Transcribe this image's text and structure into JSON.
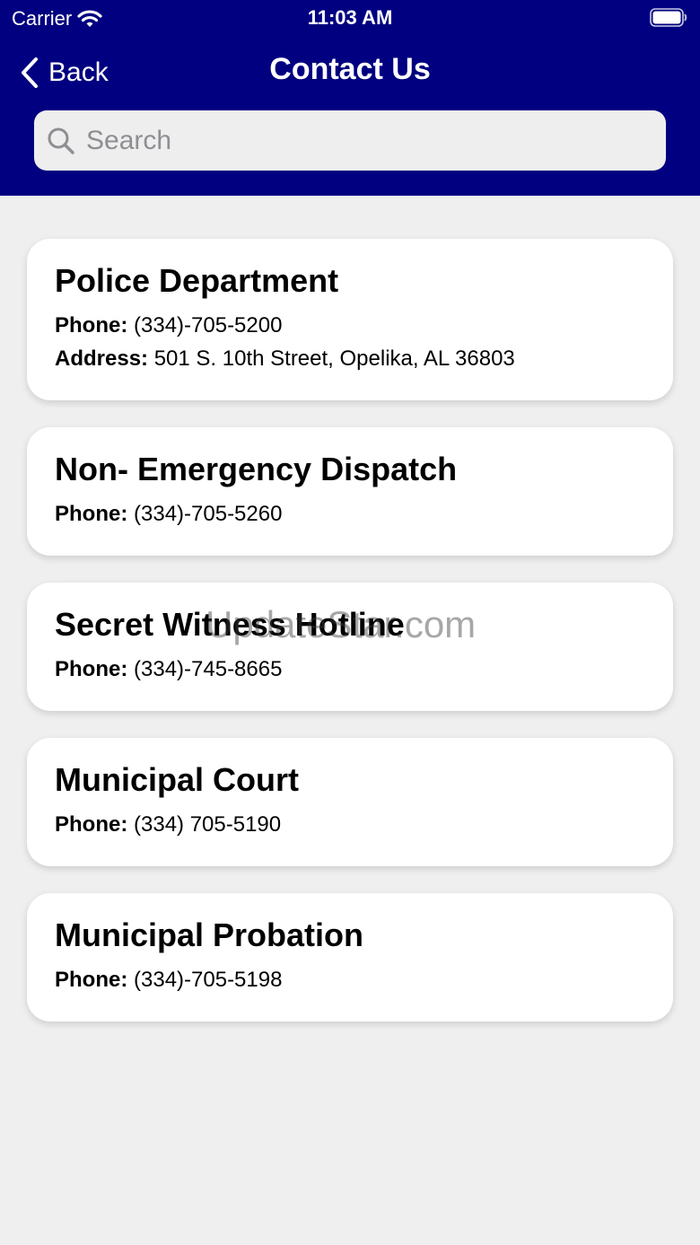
{
  "status_bar": {
    "carrier": "Carrier",
    "time": "11:03 AM"
  },
  "nav": {
    "back_label": "Back",
    "title": "Contact Us"
  },
  "search": {
    "placeholder": "Search",
    "value": ""
  },
  "contacts": [
    {
      "name": "Police Department",
      "phone_label": "Phone:",
      "phone": "(334)-705-5200",
      "address_label": "Address:",
      "address": "501 S. 10th Street, Opelika, AL 36803"
    },
    {
      "name": "Non- Emergency Dispatch",
      "phone_label": "Phone:",
      "phone": "(334)-705-5260"
    },
    {
      "name": "Secret Witness Hotline",
      "phone_label": "Phone:",
      "phone": "(334)-745-8665"
    },
    {
      "name": "Municipal Court",
      "phone_label": "Phone:",
      "phone": "(334) 705-5190"
    },
    {
      "name": "Municipal Probation",
      "phone_label": "Phone:",
      "phone": "(334)-705-5198"
    }
  ],
  "watermark": "UpdateStar.com",
  "colors": {
    "header_bg": "#000080",
    "page_bg": "#efefef",
    "card_bg": "#ffffff"
  },
  "icons": [
    "wifi-icon",
    "battery-icon",
    "chevron-left-icon",
    "search-icon"
  ]
}
